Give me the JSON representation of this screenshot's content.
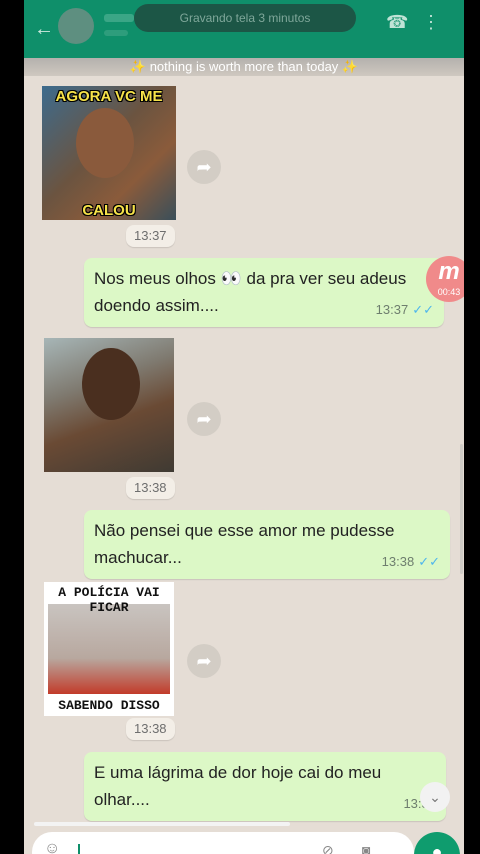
{
  "header": {
    "back_icon": "arrow-left-icon",
    "pill_text": "Gravando tela 3 minutos",
    "call_icon": "phone-icon",
    "menu_icon": "more-icon"
  },
  "banner": {
    "text": "nothing is worth more than today",
    "star": "✨"
  },
  "messages": [
    {
      "type": "sticker",
      "top_caption": "AGORA VC ME",
      "bottom_caption": "CALOU",
      "time": "13:37"
    },
    {
      "type": "text",
      "text": "Nos meus olhos 👀 da pra ver  seu adeus doendo assim....",
      "time": "13:37"
    },
    {
      "type": "sticker",
      "time": "13:38"
    },
    {
      "type": "text",
      "text": "Não pensei que esse amor me pudesse machucar...",
      "time": "13:38"
    },
    {
      "type": "sticker",
      "top_caption": "A POLÍCIA VAI FICAR",
      "bottom_caption": "SABENDO DISSO",
      "time": "13:38"
    },
    {
      "type": "text",
      "text": "E uma lágrima de dor hoje cai do meu olhar....",
      "time": "13:38"
    }
  ],
  "overlay": {
    "badge_letter": "m",
    "badge_time": "00:43"
  },
  "colors": {
    "header": "#0f8f6a",
    "outgoing_bubble": "#dcf8c6",
    "chat_bg": "#e5ddd5",
    "read_ticks": "#4fb6ec"
  }
}
